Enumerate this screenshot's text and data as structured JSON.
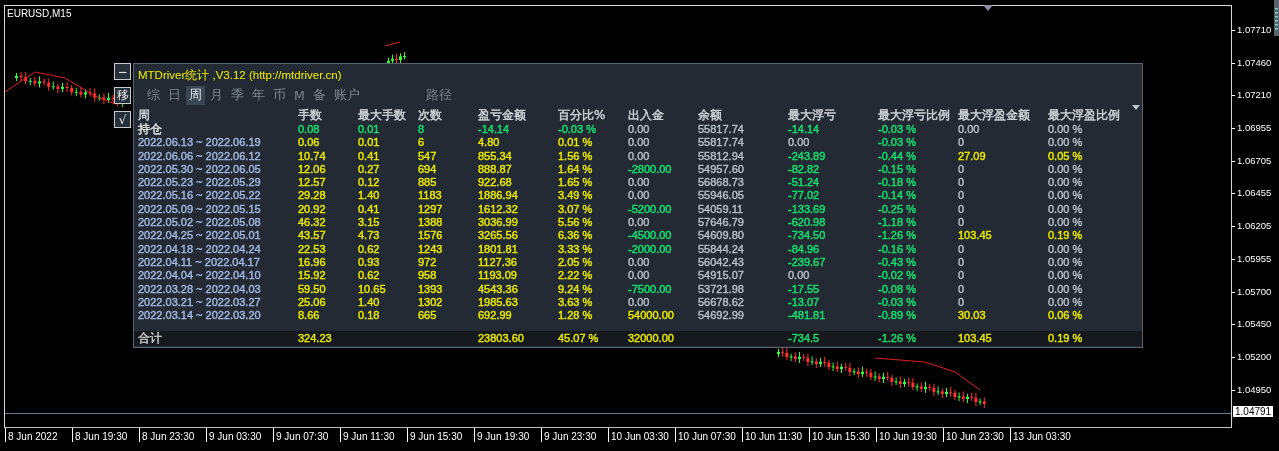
{
  "chart": {
    "symbol": "EURUSD,M15",
    "price_labels": [
      "1.07710",
      "1.07460",
      "1.07210",
      "1.06955",
      "1.06705",
      "1.06455",
      "1.06205",
      "1.05955",
      "1.05700",
      "1.05450",
      "1.05200",
      "1.04950"
    ],
    "current_price": "1.04791",
    "time_labels": [
      "8 Jun 2022",
      "8 Jun 19:30",
      "8 Jun 23:30",
      "9 Jun 03:30",
      "9 Jun 07:30",
      "9 Jun 11:30",
      "9 Jun 15:30",
      "9 Jun 19:30",
      "9 Jun 23:30",
      "10 Jun 03:30",
      "10 Jun 07:30",
      "10 Jun 11:30",
      "10 Jun 15:30",
      "10 Jun 19:30",
      "10 Jun 23:30",
      "13 Jun 03:30"
    ]
  },
  "side_buttons": [
    "−",
    "移",
    "√"
  ],
  "panel": {
    "title": "MTDriver统计 ,V3.12 (http://mtdriver.cn)",
    "tabs": [
      {
        "label": "综",
        "selected": false
      },
      {
        "label": "日",
        "selected": false
      },
      {
        "label": "周",
        "selected": true
      },
      {
        "label": "月",
        "selected": false
      },
      {
        "label": "季",
        "selected": false
      },
      {
        "label": "年",
        "selected": false
      },
      {
        "label": "币",
        "selected": false
      },
      {
        "label": "M",
        "selected": false
      },
      {
        "label": "备",
        "selected": false
      },
      {
        "label": "账户",
        "selected": false
      }
    ],
    "right_tab": {
      "label": "路径",
      "selected": false
    },
    "columns": [
      "周",
      "手数",
      "最大手数",
      "次数",
      "盈亏金额",
      "百分比%",
      "出入金",
      "余额",
      "最大浮亏",
      "最大浮亏比例",
      "最大浮盈金额",
      "最大浮盈比例"
    ],
    "rows": [
      {
        "kind": "position",
        "cells": [
          {
            "text": "持仓",
            "color": "#e0e0e0"
          },
          {
            "text": "0.08",
            "color": "#10e070"
          },
          {
            "text": "0.01",
            "color": "#10e070"
          },
          {
            "text": "8",
            "color": "#10e070"
          },
          {
            "text": "-14.14",
            "color": "#10e070"
          },
          {
            "text": "-0.03 %",
            "color": "#10e070"
          },
          {
            "text": "0.00",
            "color": "#b4bcc4"
          },
          {
            "text": "55817.74",
            "color": "#b4bcc4"
          },
          {
            "text": "-14.14",
            "color": "#10e070"
          },
          {
            "text": "-0.03 %",
            "color": "#10e070"
          },
          {
            "text": "0.00",
            "color": "#b4bcc4"
          },
          {
            "text": "0.00 %",
            "color": "#b4bcc4"
          }
        ]
      },
      {
        "kind": "week",
        "cells": [
          {
            "text": "2022.06.13 ~ 2022.06.19",
            "color": "#a0b4dc"
          },
          {
            "text": "0.06",
            "color": "#e6e600"
          },
          {
            "text": "0.01",
            "color": "#e6e600"
          },
          {
            "text": "6",
            "color": "#e6e600"
          },
          {
            "text": "4.80",
            "color": "#e6e600"
          },
          {
            "text": "0.01 %",
            "color": "#e6e600"
          },
          {
            "text": "0.00",
            "color": "#b4bcc4"
          },
          {
            "text": "55817.74",
            "color": "#b4bcc4"
          },
          {
            "text": "0.00",
            "color": "#b4bcc4"
          },
          {
            "text": "-0.03 %",
            "color": "#10e070"
          },
          {
            "text": "0",
            "color": "#b4bcc4"
          },
          {
            "text": "0.00 %",
            "color": "#b4bcc4"
          }
        ]
      },
      {
        "kind": "week",
        "cells": [
          {
            "text": "2022.06.06 ~ 2022.06.12",
            "color": "#a0b4dc"
          },
          {
            "text": "10.74",
            "color": "#e6e600"
          },
          {
            "text": "0.41",
            "color": "#e6e600"
          },
          {
            "text": "547",
            "color": "#e6e600"
          },
          {
            "text": "855.34",
            "color": "#e6e600"
          },
          {
            "text": "1.56 %",
            "color": "#e6e600"
          },
          {
            "text": "0.00",
            "color": "#b4bcc4"
          },
          {
            "text": "55812.94",
            "color": "#b4bcc4"
          },
          {
            "text": "-243.89",
            "color": "#10e070"
          },
          {
            "text": "-0.44 %",
            "color": "#10e070"
          },
          {
            "text": "27.09",
            "color": "#e6e600"
          },
          {
            "text": "0.05 %",
            "color": "#e6e600"
          }
        ]
      },
      {
        "kind": "week",
        "cells": [
          {
            "text": "2022.05.30 ~ 2022.06.05",
            "color": "#a0b4dc"
          },
          {
            "text": "12.06",
            "color": "#e6e600"
          },
          {
            "text": "0.27",
            "color": "#e6e600"
          },
          {
            "text": "694",
            "color": "#e6e600"
          },
          {
            "text": "888.87",
            "color": "#e6e600"
          },
          {
            "text": "1.64 %",
            "color": "#e6e600"
          },
          {
            "text": "-2800.00",
            "color": "#10e070"
          },
          {
            "text": "54957.60",
            "color": "#b4bcc4"
          },
          {
            "text": "-82.82",
            "color": "#10e070"
          },
          {
            "text": "-0.15 %",
            "color": "#10e070"
          },
          {
            "text": "0",
            "color": "#b4bcc4"
          },
          {
            "text": "0.00 %",
            "color": "#b4bcc4"
          }
        ]
      },
      {
        "kind": "week",
        "cells": [
          {
            "text": "2022.05.23 ~ 2022.05.29",
            "color": "#a0b4dc"
          },
          {
            "text": "12.57",
            "color": "#e6e600"
          },
          {
            "text": "0.12",
            "color": "#e6e600"
          },
          {
            "text": "885",
            "color": "#e6e600"
          },
          {
            "text": "922.68",
            "color": "#e6e600"
          },
          {
            "text": "1.65 %",
            "color": "#e6e600"
          },
          {
            "text": "0.00",
            "color": "#b4bcc4"
          },
          {
            "text": "56868.73",
            "color": "#b4bcc4"
          },
          {
            "text": "-51.24",
            "color": "#10e070"
          },
          {
            "text": "-0.18 %",
            "color": "#10e070"
          },
          {
            "text": "0",
            "color": "#b4bcc4"
          },
          {
            "text": "0.00 %",
            "color": "#b4bcc4"
          }
        ]
      },
      {
        "kind": "week",
        "cells": [
          {
            "text": "2022.05.16 ~ 2022.05.22",
            "color": "#a0b4dc"
          },
          {
            "text": "29.28",
            "color": "#e6e600"
          },
          {
            "text": "1.40",
            "color": "#e6e600"
          },
          {
            "text": "1183",
            "color": "#e6e600"
          },
          {
            "text": "1886.94",
            "color": "#e6e600"
          },
          {
            "text": "3.49 %",
            "color": "#e6e600"
          },
          {
            "text": "0.00",
            "color": "#b4bcc4"
          },
          {
            "text": "55946.05",
            "color": "#b4bcc4"
          },
          {
            "text": "-77.02",
            "color": "#10e070"
          },
          {
            "text": "-0.14 %",
            "color": "#10e070"
          },
          {
            "text": "0",
            "color": "#b4bcc4"
          },
          {
            "text": "0.00 %",
            "color": "#b4bcc4"
          }
        ]
      },
      {
        "kind": "week",
        "cells": [
          {
            "text": "2022.05.09 ~ 2022.05.15",
            "color": "#a0b4dc"
          },
          {
            "text": "20.92",
            "color": "#e6e600"
          },
          {
            "text": "0.41",
            "color": "#e6e600"
          },
          {
            "text": "1297",
            "color": "#e6e600"
          },
          {
            "text": "1612.32",
            "color": "#e6e600"
          },
          {
            "text": "3.07 %",
            "color": "#e6e600"
          },
          {
            "text": "-5200.00",
            "color": "#10e070"
          },
          {
            "text": "54059.11",
            "color": "#b4bcc4"
          },
          {
            "text": "-133.69",
            "color": "#10e070"
          },
          {
            "text": "-0.25 %",
            "color": "#10e070"
          },
          {
            "text": "0",
            "color": "#b4bcc4"
          },
          {
            "text": "0.00 %",
            "color": "#b4bcc4"
          }
        ]
      },
      {
        "kind": "week",
        "cells": [
          {
            "text": "2022.05.02 ~ 2022.05.08",
            "color": "#a0b4dc"
          },
          {
            "text": "46.32",
            "color": "#e6e600"
          },
          {
            "text": "3.15",
            "color": "#e6e600"
          },
          {
            "text": "1388",
            "color": "#e6e600"
          },
          {
            "text": "3036.99",
            "color": "#e6e600"
          },
          {
            "text": "5.56 %",
            "color": "#e6e600"
          },
          {
            "text": "0.00",
            "color": "#b4bcc4"
          },
          {
            "text": "57646.79",
            "color": "#b4bcc4"
          },
          {
            "text": "-620.98",
            "color": "#10e070"
          },
          {
            "text": "-1.18 %",
            "color": "#10e070"
          },
          {
            "text": "0",
            "color": "#b4bcc4"
          },
          {
            "text": "0.00 %",
            "color": "#b4bcc4"
          }
        ]
      },
      {
        "kind": "week",
        "cells": [
          {
            "text": "2022.04.25 ~ 2022.05.01",
            "color": "#a0b4dc"
          },
          {
            "text": "43.57",
            "color": "#e6e600"
          },
          {
            "text": "4.73",
            "color": "#e6e600"
          },
          {
            "text": "1576",
            "color": "#e6e600"
          },
          {
            "text": "3265.56",
            "color": "#e6e600"
          },
          {
            "text": "6.36 %",
            "color": "#e6e600"
          },
          {
            "text": "-4500.00",
            "color": "#10e070"
          },
          {
            "text": "54609.80",
            "color": "#b4bcc4"
          },
          {
            "text": "-734.50",
            "color": "#10e070"
          },
          {
            "text": "-1.26 %",
            "color": "#10e070"
          },
          {
            "text": "103.45",
            "color": "#e6e600"
          },
          {
            "text": "0.19 %",
            "color": "#e6e600"
          }
        ]
      },
      {
        "kind": "week",
        "cells": [
          {
            "text": "2022.04.18 ~ 2022.04.24",
            "color": "#a0b4dc"
          },
          {
            "text": "22.53",
            "color": "#e6e600"
          },
          {
            "text": "0.62",
            "color": "#e6e600"
          },
          {
            "text": "1243",
            "color": "#e6e600"
          },
          {
            "text": "1801.81",
            "color": "#e6e600"
          },
          {
            "text": "3.33 %",
            "color": "#e6e600"
          },
          {
            "text": "-2000.00",
            "color": "#10e070"
          },
          {
            "text": "55844.24",
            "color": "#b4bcc4"
          },
          {
            "text": "-84.96",
            "color": "#10e070"
          },
          {
            "text": "-0.16 %",
            "color": "#10e070"
          },
          {
            "text": "0",
            "color": "#b4bcc4"
          },
          {
            "text": "0.00 %",
            "color": "#b4bcc4"
          }
        ]
      },
      {
        "kind": "week",
        "cells": [
          {
            "text": "2022.04.11 ~ 2022.04.17",
            "color": "#a0b4dc"
          },
          {
            "text": "16.96",
            "color": "#e6e600"
          },
          {
            "text": "0.93",
            "color": "#e6e600"
          },
          {
            "text": "972",
            "color": "#e6e600"
          },
          {
            "text": "1127.36",
            "color": "#e6e600"
          },
          {
            "text": "2.05 %",
            "color": "#e6e600"
          },
          {
            "text": "0.00",
            "color": "#b4bcc4"
          },
          {
            "text": "56042.43",
            "color": "#b4bcc4"
          },
          {
            "text": "-239.67",
            "color": "#10e070"
          },
          {
            "text": "-0.43 %",
            "color": "#10e070"
          },
          {
            "text": "0",
            "color": "#b4bcc4"
          },
          {
            "text": "0.00 %",
            "color": "#b4bcc4"
          }
        ]
      },
      {
        "kind": "week",
        "cells": [
          {
            "text": "2022.04.04 ~ 2022.04.10",
            "color": "#a0b4dc"
          },
          {
            "text": "15.92",
            "color": "#e6e600"
          },
          {
            "text": "0.62",
            "color": "#e6e600"
          },
          {
            "text": "958",
            "color": "#e6e600"
          },
          {
            "text": "1193.09",
            "color": "#e6e600"
          },
          {
            "text": "2.22 %",
            "color": "#e6e600"
          },
          {
            "text": "0.00",
            "color": "#b4bcc4"
          },
          {
            "text": "54915.07",
            "color": "#b4bcc4"
          },
          {
            "text": "0.00",
            "color": "#b4bcc4"
          },
          {
            "text": "-0.02 %",
            "color": "#10e070"
          },
          {
            "text": "0",
            "color": "#b4bcc4"
          },
          {
            "text": "0.00 %",
            "color": "#b4bcc4"
          }
        ]
      },
      {
        "kind": "week",
        "cells": [
          {
            "text": "2022.03.28 ~ 2022.04.03",
            "color": "#a0b4dc"
          },
          {
            "text": "59.50",
            "color": "#e6e600"
          },
          {
            "text": "10.65",
            "color": "#e6e600"
          },
          {
            "text": "1393",
            "color": "#e6e600"
          },
          {
            "text": "4543.36",
            "color": "#e6e600"
          },
          {
            "text": "9.24 %",
            "color": "#e6e600"
          },
          {
            "text": "-7500.00",
            "color": "#10e070"
          },
          {
            "text": "53721.98",
            "color": "#b4bcc4"
          },
          {
            "text": "-17.55",
            "color": "#10e070"
          },
          {
            "text": "-0.08 %",
            "color": "#10e070"
          },
          {
            "text": "0",
            "color": "#b4bcc4"
          },
          {
            "text": "0.00 %",
            "color": "#b4bcc4"
          }
        ]
      },
      {
        "kind": "week",
        "cells": [
          {
            "text": "2022.03.21 ~ 2022.03.27",
            "color": "#a0b4dc"
          },
          {
            "text": "25.06",
            "color": "#e6e600"
          },
          {
            "text": "1.40",
            "color": "#e6e600"
          },
          {
            "text": "1302",
            "color": "#e6e600"
          },
          {
            "text": "1985.63",
            "color": "#e6e600"
          },
          {
            "text": "3.63 %",
            "color": "#e6e600"
          },
          {
            "text": "0.00",
            "color": "#b4bcc4"
          },
          {
            "text": "56678.62",
            "color": "#b4bcc4"
          },
          {
            "text": "-13.07",
            "color": "#10e070"
          },
          {
            "text": "-0.03 %",
            "color": "#10e070"
          },
          {
            "text": "0",
            "color": "#b4bcc4"
          },
          {
            "text": "0.00 %",
            "color": "#b4bcc4"
          }
        ]
      },
      {
        "kind": "week",
        "cells": [
          {
            "text": "2022.03.14 ~ 2022.03.20",
            "color": "#a0b4dc"
          },
          {
            "text": "8.66",
            "color": "#e6e600"
          },
          {
            "text": "0.18",
            "color": "#e6e600"
          },
          {
            "text": "665",
            "color": "#e6e600"
          },
          {
            "text": "692.99",
            "color": "#e6e600"
          },
          {
            "text": "1.28 %",
            "color": "#e6e600"
          },
          {
            "text": "54000.00",
            "color": "#e6e600"
          },
          {
            "text": "54692.99",
            "color": "#b4bcc4"
          },
          {
            "text": "-481.81",
            "color": "#10e070"
          },
          {
            "text": "-0.89 %",
            "color": "#10e070"
          },
          {
            "text": "30.03",
            "color": "#e6e600"
          },
          {
            "text": "0.06 %",
            "color": "#e6e600"
          }
        ]
      },
      {
        "kind": "total",
        "cells": [
          {
            "text": "合计",
            "color": "#c8c8c8"
          },
          {
            "text": "324.23",
            "color": "#e6e600"
          },
          null,
          null,
          {
            "text": "23803.60",
            "color": "#e6e600"
          },
          {
            "text": "45.07 %",
            "color": "#e6e600"
          },
          {
            "text": "32000.00",
            "color": "#e6e600"
          },
          null,
          {
            "text": "-734.5",
            "color": "#10e070"
          },
          {
            "text": "-1.26 %",
            "color": "#10e070"
          },
          {
            "text": "103.45",
            "color": "#e6e600"
          },
          {
            "text": "0.19 %",
            "color": "#e6e600"
          }
        ]
      }
    ]
  }
}
